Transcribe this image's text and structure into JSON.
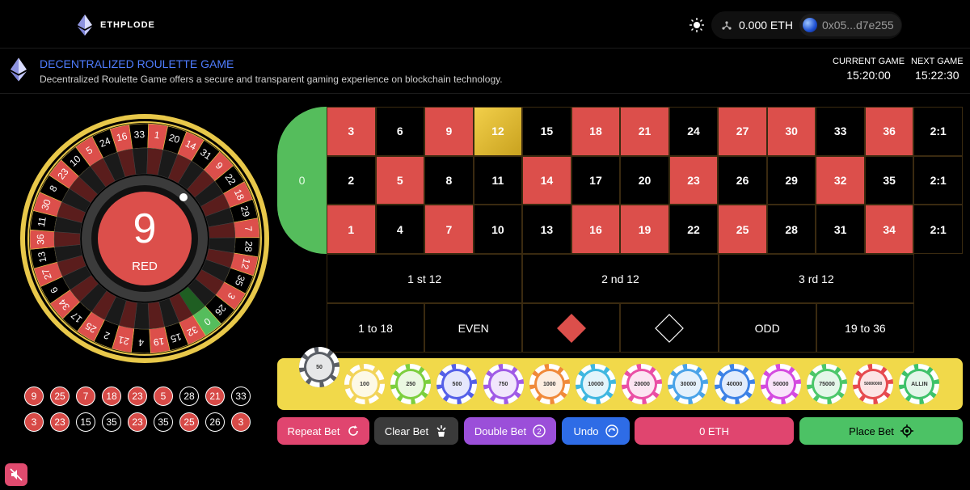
{
  "brand": {
    "name": "ETHPLODE"
  },
  "wallet": {
    "balance": "0.000 ETH",
    "address": "0x05...d7e255"
  },
  "header": {
    "title": "DECENTRALIZED ROULETTE GAME",
    "description": "Decentralized Roulette Game offers a secure and transparent gaming experience on blockchain technology.",
    "current_game_label": "CURRENT GAME",
    "current_game_time": "15:20:00",
    "next_game_label": "NEXT GAME",
    "next_game_time": "15:22:30"
  },
  "wheel": {
    "result_number": "9",
    "result_color": "RED",
    "numbers": [
      "0",
      "32",
      "15",
      "19",
      "4",
      "21",
      "2",
      "25",
      "17",
      "34",
      "6",
      "27",
      "13",
      "36",
      "11",
      "30",
      "8",
      "23",
      "10",
      "5",
      "24",
      "16",
      "33",
      "1",
      "20",
      "14",
      "31",
      "9",
      "22",
      "18",
      "29",
      "7",
      "28",
      "12",
      "35",
      "3",
      "26"
    ]
  },
  "history": [
    {
      "n": "9",
      "c": "red"
    },
    {
      "n": "25",
      "c": "red"
    },
    {
      "n": "7",
      "c": "red"
    },
    {
      "n": "18",
      "c": "red"
    },
    {
      "n": "23",
      "c": "red"
    },
    {
      "n": "5",
      "c": "red"
    },
    {
      "n": "28",
      "c": "black"
    },
    {
      "n": "21",
      "c": "red"
    },
    {
      "n": "33",
      "c": "black"
    },
    {
      "n": "3",
      "c": "red"
    },
    {
      "n": "23",
      "c": "red"
    },
    {
      "n": "15",
      "c": "black"
    },
    {
      "n": "35",
      "c": "black"
    },
    {
      "n": "23",
      "c": "red"
    },
    {
      "n": "35",
      "c": "black"
    },
    {
      "n": "25",
      "c": "red"
    },
    {
      "n": "26",
      "c": "black"
    },
    {
      "n": "3",
      "c": "red"
    }
  ],
  "table": {
    "zero": "0",
    "rows": [
      [
        {
          "n": "3",
          "c": "red"
        },
        {
          "n": "6",
          "c": "black"
        },
        {
          "n": "9",
          "c": "red"
        },
        {
          "n": "12",
          "c": "gold"
        },
        {
          "n": "15",
          "c": "black"
        },
        {
          "n": "18",
          "c": "red"
        },
        {
          "n": "21",
          "c": "red"
        },
        {
          "n": "24",
          "c": "black"
        },
        {
          "n": "27",
          "c": "red"
        },
        {
          "n": "30",
          "c": "red"
        },
        {
          "n": "33",
          "c": "black"
        },
        {
          "n": "36",
          "c": "red"
        },
        {
          "n": "2:1",
          "c": "black"
        }
      ],
      [
        {
          "n": "2",
          "c": "black"
        },
        {
          "n": "5",
          "c": "red"
        },
        {
          "n": "8",
          "c": "black"
        },
        {
          "n": "11",
          "c": "black"
        },
        {
          "n": "14",
          "c": "red"
        },
        {
          "n": "17",
          "c": "black"
        },
        {
          "n": "20",
          "c": "black"
        },
        {
          "n": "23",
          "c": "red"
        },
        {
          "n": "26",
          "c": "black"
        },
        {
          "n": "29",
          "c": "black"
        },
        {
          "n": "32",
          "c": "red"
        },
        {
          "n": "35",
          "c": "black"
        },
        {
          "n": "2:1",
          "c": "black"
        }
      ],
      [
        {
          "n": "1",
          "c": "red"
        },
        {
          "n": "4",
          "c": "black"
        },
        {
          "n": "7",
          "c": "red"
        },
        {
          "n": "10",
          "c": "black"
        },
        {
          "n": "13",
          "c": "black"
        },
        {
          "n": "16",
          "c": "red"
        },
        {
          "n": "19",
          "c": "red"
        },
        {
          "n": "22",
          "c": "black"
        },
        {
          "n": "25",
          "c": "red"
        },
        {
          "n": "28",
          "c": "black"
        },
        {
          "n": "31",
          "c": "black"
        },
        {
          "n": "34",
          "c": "red"
        },
        {
          "n": "2:1",
          "c": "black"
        }
      ]
    ],
    "dozens": [
      "1 st 12",
      "2 nd 12",
      "3 rd 12"
    ],
    "outside": {
      "low": "1 to 18",
      "even": "EVEN",
      "red_icon": "red-diamond-icon",
      "black_icon": "black-diamond-icon",
      "odd": "ODD",
      "high": "19 to 36"
    }
  },
  "chips": [
    {
      "label": "50",
      "color": "#5b5f66"
    },
    {
      "label": "100",
      "color": "#f2d45a"
    },
    {
      "label": "250",
      "color": "#7ccf3e"
    },
    {
      "label": "500",
      "color": "#5460e8"
    },
    {
      "label": "750",
      "color": "#a05be6"
    },
    {
      "label": "1000",
      "color": "#f08a3a"
    },
    {
      "label": "10000",
      "color": "#3fb7e0"
    },
    {
      "label": "20000",
      "color": "#ea4fa5"
    },
    {
      "label": "30000",
      "color": "#4aa3e8"
    },
    {
      "label": "40000",
      "color": "#3d82e6"
    },
    {
      "label": "50000",
      "color": "#d44be0"
    },
    {
      "label": "75000",
      "color": "#4cc76a"
    },
    {
      "label": "50000000",
      "color": "#e64a4f"
    },
    {
      "label": "ALLIN",
      "color": "#3ec26a"
    }
  ],
  "actions": {
    "repeat": "Repeat Bet",
    "clear": "Clear Bet",
    "double": "Double Bet",
    "undo": "Undo",
    "amount": "0 ETH",
    "place": "Place Bet"
  },
  "colors": {
    "red": "#dc4f4b",
    "green": "#55bd5c",
    "gold": "#f1d94a",
    "accent_blue": "#4f7dff"
  }
}
